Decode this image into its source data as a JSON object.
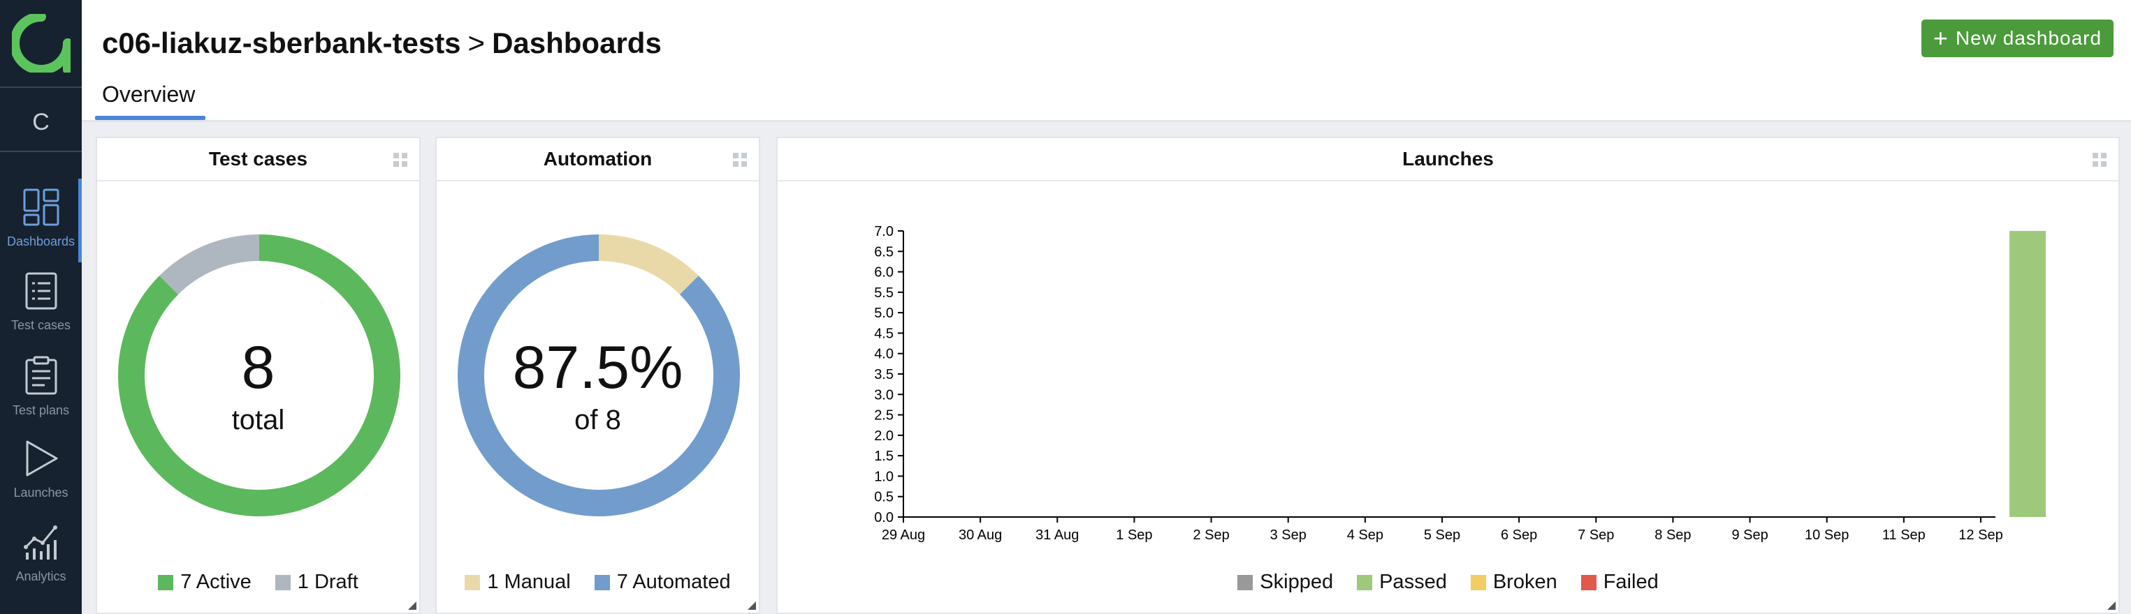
{
  "sidebar": {
    "project_letter": "C",
    "items": [
      {
        "label": "Dashboards",
        "icon": "dashboard-icon",
        "active": true
      },
      {
        "label": "Test cases",
        "icon": "test-cases-icon",
        "active": false
      },
      {
        "label": "Test plans",
        "icon": "test-plans-icon",
        "active": false
      },
      {
        "label": "Launches",
        "icon": "launches-icon",
        "active": false
      },
      {
        "label": "Analytics",
        "icon": "analytics-icon",
        "active": false
      }
    ]
  },
  "header": {
    "project": "c06-liakuz-sberbank-tests",
    "separator": ">",
    "page": "Dashboards",
    "new_button": "New dashboard",
    "tab": "Overview"
  },
  "colors": {
    "accent_blue": "#4a86d9",
    "green": "#5cb85c",
    "gray": "#aeb6bf",
    "beige": "#ead9a8",
    "blue": "#729ccc",
    "passed": "#9ec97a",
    "skipped": "#999999",
    "broken": "#f3cc63",
    "failed": "#e0594a",
    "button_green": "#4b9a3b"
  },
  "widgets": {
    "test_cases": {
      "title": "Test cases",
      "center_value": "8",
      "center_label": "total",
      "legend": [
        "7 Active",
        "1 Draft"
      ]
    },
    "automation": {
      "title": "Automation",
      "center_value": "87.5%",
      "center_label": "of 8",
      "legend": [
        "1 Manual",
        "7 Automated"
      ]
    },
    "launches": {
      "title": "Launches",
      "legend": [
        "Skipped",
        "Passed",
        "Broken",
        "Failed"
      ]
    }
  },
  "chart_data": [
    {
      "type": "pie",
      "title": "Test cases",
      "categories": [
        "Active",
        "Draft"
      ],
      "values": [
        7,
        1
      ],
      "colors": [
        "#5cb85c",
        "#aeb6bf"
      ]
    },
    {
      "type": "pie",
      "title": "Automation",
      "categories": [
        "Manual",
        "Automated"
      ],
      "values": [
        1,
        7
      ],
      "colors": [
        "#ead9a8",
        "#729ccc"
      ]
    },
    {
      "type": "bar",
      "title": "Launches",
      "categories": [
        "29 Aug",
        "30 Aug",
        "31 Aug",
        "1 Sep",
        "2 Sep",
        "3 Sep",
        "4 Sep",
        "5 Sep",
        "6 Sep",
        "7 Sep",
        "8 Sep",
        "9 Sep",
        "10 Sep",
        "11 Sep",
        "12 Sep"
      ],
      "series": [
        {
          "name": "Skipped",
          "color": "#999999",
          "values": [
            0,
            0,
            0,
            0,
            0,
            0,
            0,
            0,
            0,
            0,
            0,
            0,
            0,
            0,
            0
          ]
        },
        {
          "name": "Passed",
          "color": "#9ec97a",
          "values": [
            0,
            0,
            0,
            0,
            0,
            0,
            0,
            0,
            0,
            0,
            0,
            0,
            0,
            0,
            7
          ]
        },
        {
          "name": "Broken",
          "color": "#f3cc63",
          "values": [
            0,
            0,
            0,
            0,
            0,
            0,
            0,
            0,
            0,
            0,
            0,
            0,
            0,
            0,
            0
          ]
        },
        {
          "name": "Failed",
          "color": "#e0594a",
          "values": [
            0,
            0,
            0,
            0,
            0,
            0,
            0,
            0,
            0,
            0,
            0,
            0,
            0,
            0,
            0
          ]
        }
      ],
      "ylim": [
        0,
        7
      ],
      "yticks": [
        "0.0",
        "0.5",
        "1.0",
        "1.5",
        "2.0",
        "2.5",
        "3.0",
        "3.5",
        "4.0",
        "4.5",
        "5.0",
        "5.5",
        "6.0",
        "6.5",
        "7.0"
      ],
      "stacked": true,
      "legend_position": "bottom"
    }
  ]
}
